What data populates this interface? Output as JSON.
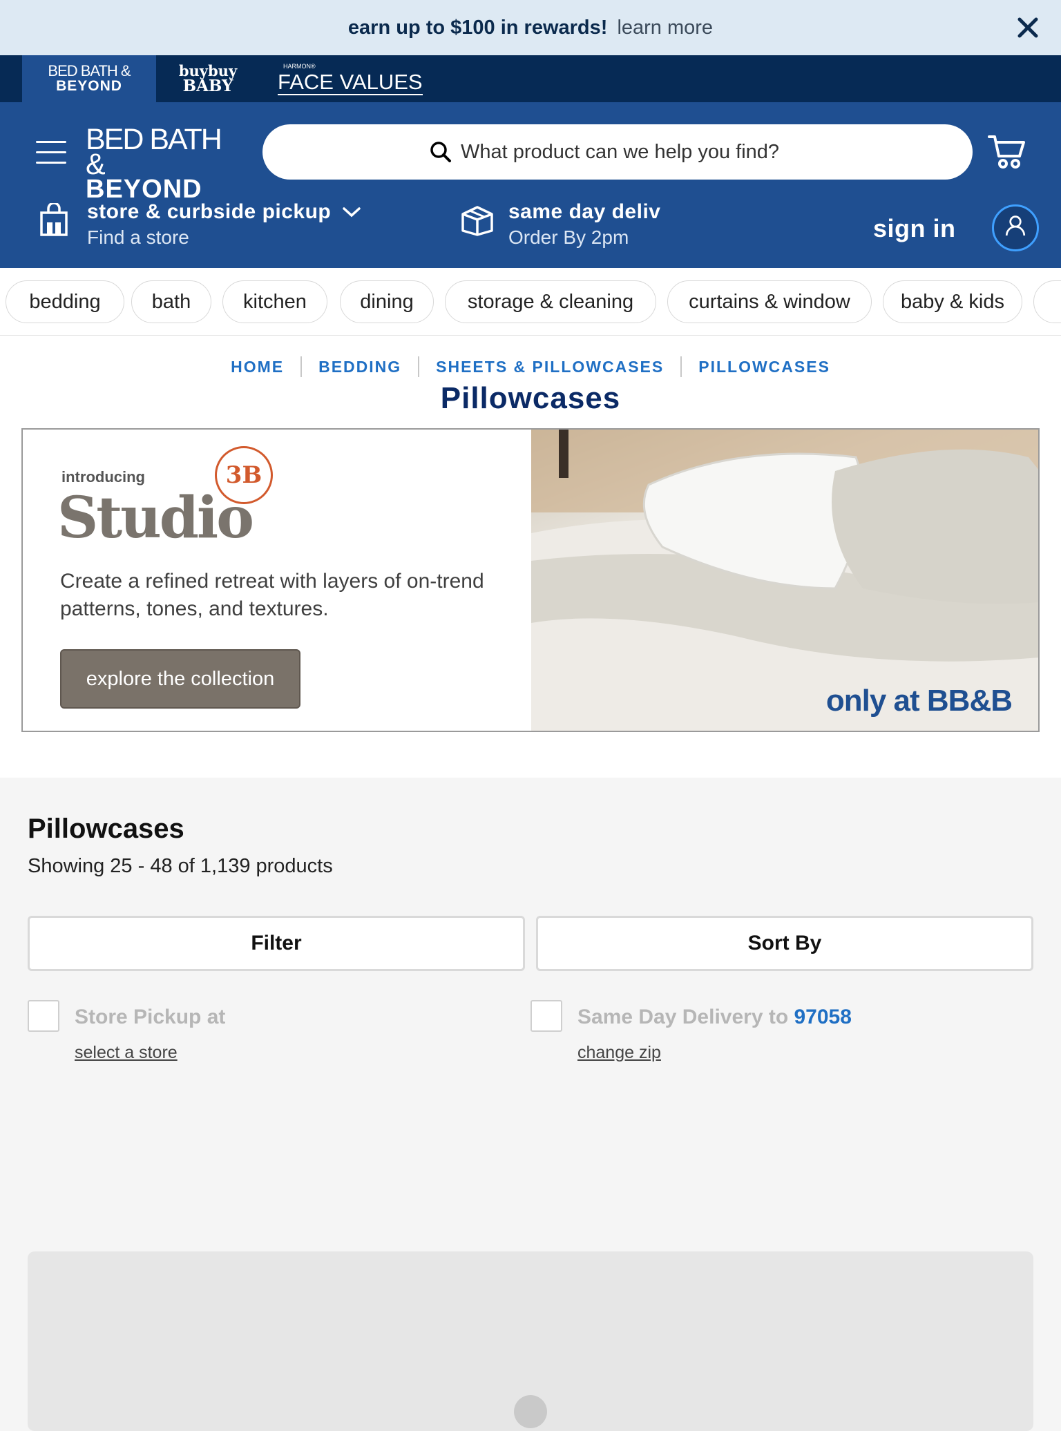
{
  "promo": {
    "bold": "earn up to $100 in rewards!",
    "link": "learn more"
  },
  "brands": {
    "bbb": {
      "l1": "BED BATH &",
      "l2": "BEYOND"
    },
    "baby": {
      "l1": "buybuy",
      "l2": "BABY"
    },
    "face": {
      "harmon": "HARMON®",
      "fv": "FACE VALUES"
    }
  },
  "header": {
    "logo": {
      "l1": "BED BATH &",
      "l2": "BEYOND"
    },
    "search_placeholder": "What product can we help you find?",
    "pickup": {
      "title": "store & curbside pickup",
      "subtitle": "Find a store"
    },
    "sameday": {
      "title": "same day deliv",
      "subtitle": "Order By 2pm"
    },
    "signin": "sign in"
  },
  "categories": [
    "bedding",
    "bath",
    "kitchen",
    "dining",
    "storage & cleaning",
    "curtains & window",
    "baby & kids"
  ],
  "breadcrumbs": [
    "HOME",
    "BEDDING",
    "SHEETS & PILLOWCASES",
    "PILLOWCASES"
  ],
  "page_title": "Pillowcases",
  "banner": {
    "intro": "introducing",
    "studio": "Studio",
    "seal": "3B",
    "blurb": "Create a refined retreat with layers of on-trend patterns, tones, and textures.",
    "cta": "explore the collection",
    "only": "only at BB&B"
  },
  "listing": {
    "title": "Pillowcases",
    "count": "Showing 25 - 48 of 1,139 products",
    "filter": "Filter",
    "sort": "Sort By",
    "store_pickup": "Store Pickup at",
    "select_store": "select a store",
    "same_day": "Same Day Delivery to",
    "zip": "97058",
    "change_zip": "change zip"
  },
  "colors": {
    "brand_blue": "#1f4f91",
    "navy": "#062a55",
    "link_blue": "#1f6fc4",
    "promo_bg": "#dde9f3"
  }
}
